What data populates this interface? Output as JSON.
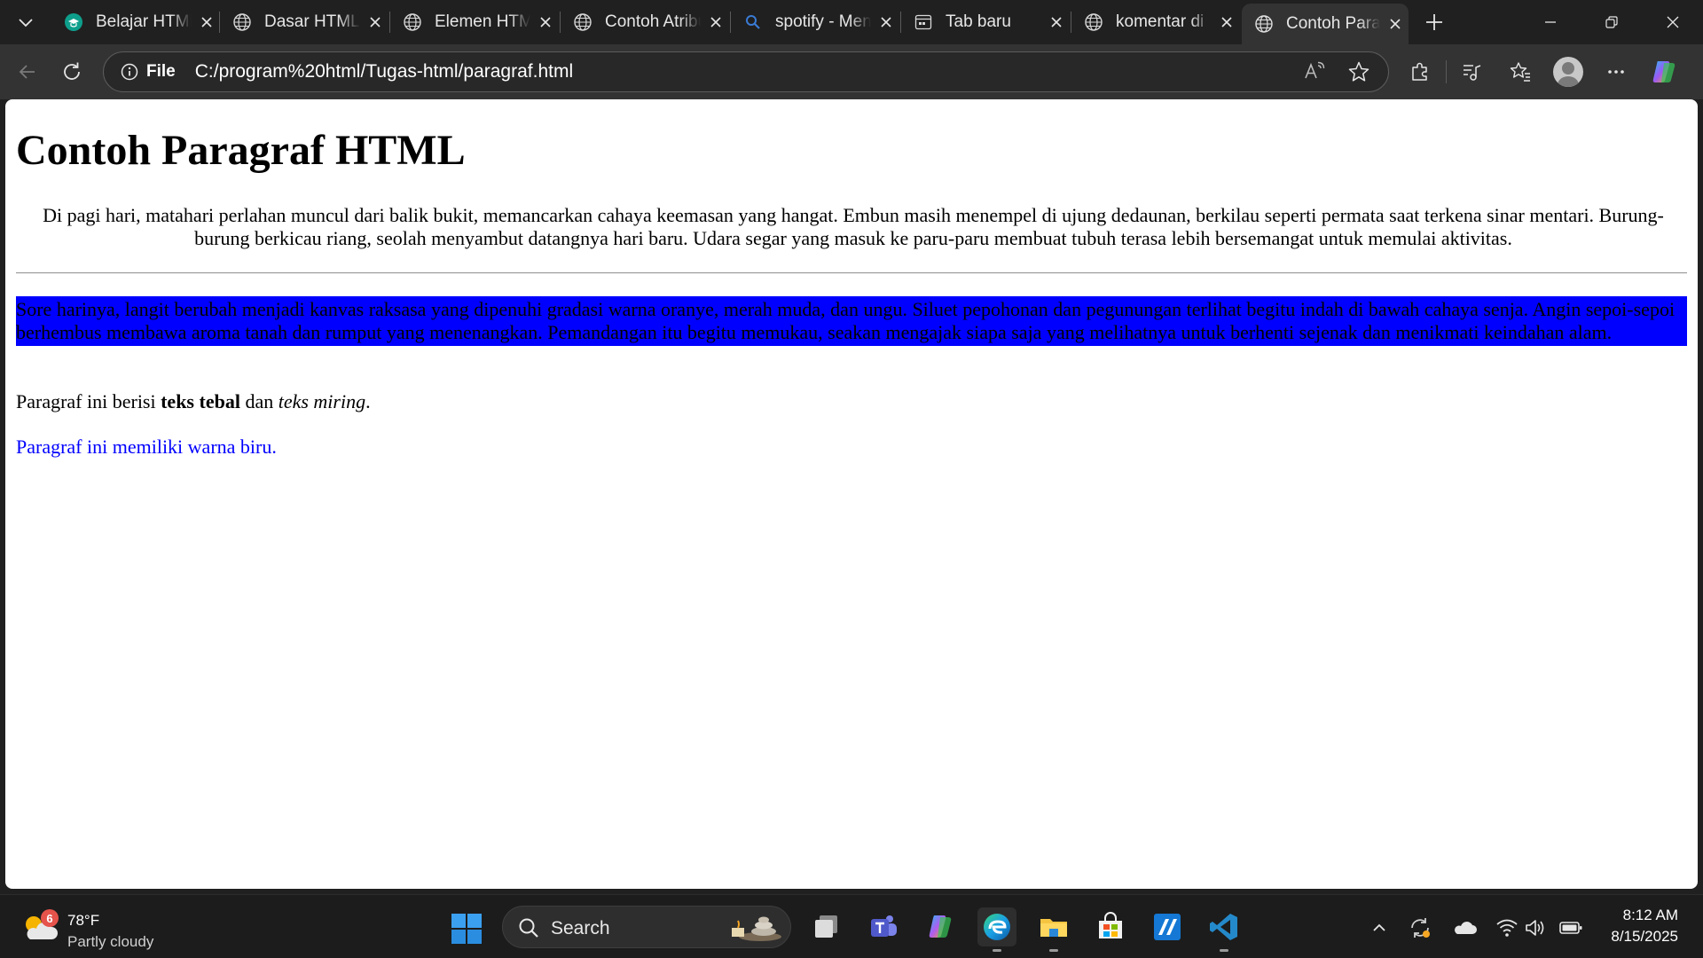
{
  "browser": {
    "tabs": [
      {
        "title": "Belajar HTML",
        "icon": "graduation-icon",
        "active": false
      },
      {
        "title": "Dasar HTML",
        "icon": "globe-icon",
        "active": false
      },
      {
        "title": "Elemen HTML",
        "icon": "globe-icon",
        "active": false
      },
      {
        "title": "Contoh Atribut",
        "icon": "globe-icon",
        "active": false
      },
      {
        "title": "spotify - Mencari",
        "icon": "search-icon",
        "active": false
      },
      {
        "title": "Tab baru",
        "icon": "newtab-icon",
        "active": false
      },
      {
        "title": "komentar di",
        "icon": "globe-icon",
        "active": false
      },
      {
        "title": "Contoh Paragraf",
        "icon": "globe-icon",
        "active": true
      }
    ],
    "address": {
      "scheme_label": "File",
      "url": "C:/program%20html/Tugas-html/paragraf.html"
    }
  },
  "page": {
    "heading": "Contoh Paragraf HTML",
    "p1": "Di pagi hari, matahari perlahan muncul dari balik bukit, memancarkan cahaya keemasan yang hangat. Embun masih menempel di ujung dedaunan, berkilau seperti permata saat terkena sinar mentari. Burung-burung berkicau riang, seolah menyambut datangnya hari baru. Udara segar yang masuk ke paru-paru membuat tubuh terasa lebih bersemangat untuk memulai aktivitas.",
    "p2": "Sore harinya, langit berubah menjadi kanvas raksasa yang dipenuhi gradasi warna oranye, merah muda, dan ungu. Siluet pepohonan dan pegunungan terlihat begitu indah di bawah cahaya senja. Angin sepoi-sepoi berhembus membawa aroma tanah dan rumput yang menenangkan. Pemandangan itu begitu memukau, seakan mengajak siapa saja yang melihatnya untuk berhenti sejenak dan menikmati keindahan alam.",
    "p2_background": "#0000ff",
    "p3": {
      "before": "Paragraf ini berisi ",
      "bold": "teks tebal",
      "middle": " dan ",
      "italic": "teks miring",
      "after": "."
    },
    "p4": "Paragraf ini memiliki warna biru.",
    "p4_color": "#0000ff"
  },
  "taskbar": {
    "weather": {
      "temp": "78°F",
      "desc": "Partly cloudy",
      "badge": "6"
    },
    "search_label": "Search",
    "apps": [
      "task-view-icon",
      "teams-icon",
      "copilot-icon",
      "edge-icon",
      "file-explorer-icon",
      "store-icon",
      "app-icon",
      "vscode-icon"
    ],
    "clock": {
      "time": "8:12 AM",
      "date": "8/15/2025"
    }
  }
}
